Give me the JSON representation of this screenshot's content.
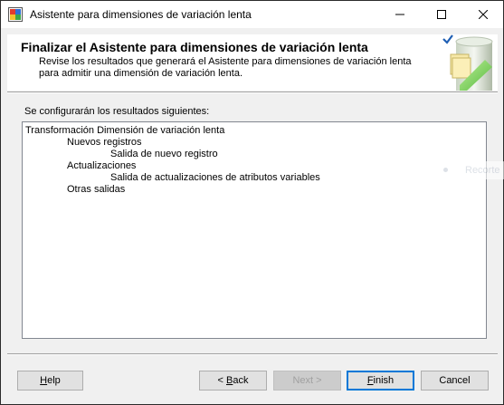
{
  "window": {
    "title": "Asistente para dimensiones de variación lenta"
  },
  "header": {
    "title": "Finalizar el Asistente para dimensiones de variación lenta",
    "description": "Revise los resultados que generará el Asistente para dimensiones de variación lenta para admitir una dimensión de variación lenta."
  },
  "results": {
    "label": "Se configurarán los resultados siguientes:",
    "lines": [
      {
        "text": "Transformación Dimensión de variación lenta",
        "indent": 0
      },
      {
        "text": "Nuevos registros",
        "indent": 1
      },
      {
        "text": "Salida de nuevo registro",
        "indent": 2
      },
      {
        "text": "Actualizaciones",
        "indent": 1
      },
      {
        "text": "Salida de actualizaciones de atributos variables",
        "indent": 2
      },
      {
        "text": "Otras salidas",
        "indent": 1
      }
    ]
  },
  "overlay": {
    "text": "Recorte"
  },
  "buttons": {
    "help": {
      "pre": "",
      "accel": "H",
      "post": "elp"
    },
    "back": {
      "pre": "< ",
      "accel": "B",
      "post": "ack"
    },
    "next": {
      "label": "Next >",
      "disabled": true
    },
    "finish": {
      "pre": "",
      "accel": "F",
      "post": "inish"
    },
    "cancel": {
      "label": "Cancel"
    }
  },
  "icons": {
    "app": "wizard-app-icon",
    "minimize": "minimize-icon",
    "maximize": "maximize-icon",
    "close": "close-icon",
    "header": "wizard-header-graphic"
  },
  "colors": {
    "accent": "#0078d7",
    "header_bg": "#ffffff",
    "dialog_bg": "#f0f0f0"
  }
}
